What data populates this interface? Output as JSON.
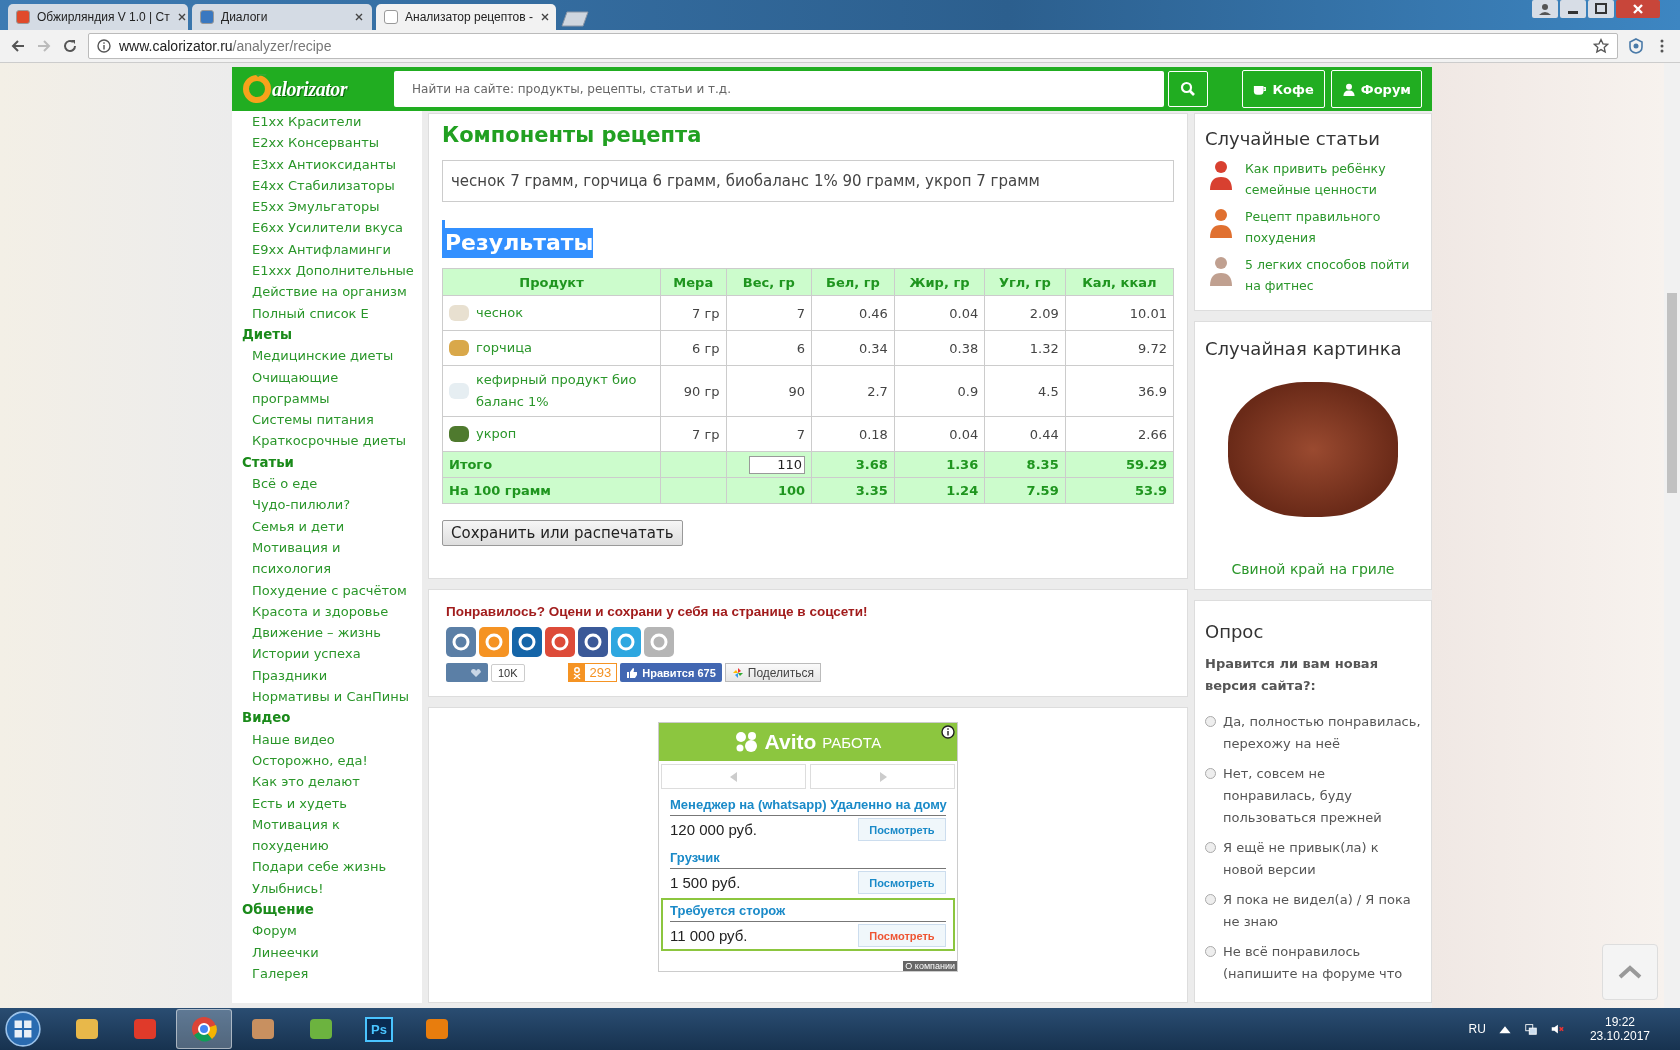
{
  "browser": {
    "tabs": [
      {
        "title": "Обжирляндия V 1.0 | Ст",
        "selected": false
      },
      {
        "title": "Диалоги",
        "selected": false
      },
      {
        "title": "Анализатор рецептов -",
        "selected": true
      }
    ],
    "url_host": "www.calorizator.ru",
    "url_path": "/analyzer/recipe"
  },
  "header": {
    "logo": "alorizator",
    "search_placeholder": "Найти на сайте: продукты, рецепты, статьи и т.д.",
    "buttons": [
      "Кофе",
      "Форум"
    ]
  },
  "sidebar": {
    "sections": [
      {
        "items": [
          "E1xx Красители",
          "E2xx Консерванты",
          "E3xx Антиоксиданты",
          "E4xx Стабилизаторы",
          "E5xx Эмульгаторы",
          "E6xx Усилители вкуса",
          "E9xx Антифламинги",
          "E1xxx Дополнительные",
          "Действие на организм",
          "Полный список Е"
        ]
      },
      {
        "heading": "Диеты",
        "items": [
          "Медицинские диеты",
          "Очищающие программы",
          "Системы питания",
          "Краткосрочные диеты"
        ]
      },
      {
        "heading": "Статьи",
        "items": [
          "Всё о еде",
          "Чудо-пилюли?",
          "Семья и дети",
          "Мотивация и психология",
          "Похудение с расчётом",
          "Красота и здоровье",
          "Движение – жизнь",
          "Истории успеха",
          "Праздники",
          "Нормативы и СанПины"
        ]
      },
      {
        "heading": "Видео",
        "items": [
          "Наше видео",
          "Осторожно, еда!",
          "Как это делают",
          "Есть и худеть",
          "Мотивация к похудению",
          "Подари себе жизнь",
          "Улыбнись!"
        ]
      },
      {
        "heading": "Общение",
        "items": [
          "Форум",
          "Линеечки",
          "Галерея"
        ]
      }
    ]
  },
  "recipe": {
    "title": "Компоненты рецепта",
    "ingredients": "чеснок 7 грамм, горчица 6 грамм, биобаланс 1% 90 грамм, укроп 7 грамм",
    "results_title": "Результаты",
    "results_highlighted": true,
    "table": {
      "columns": [
        "Продукт",
        "Мера",
        "Вес, гр",
        "Бел, гр",
        "Жир, гр",
        "Угл, гр",
        "Кал, ккал"
      ],
      "rows": [
        {
          "kind": "product",
          "name": "чеснок",
          "measure": "7 гр",
          "weight": "7",
          "protein": "0.46",
          "fat": "0.04",
          "carbs": "2.09",
          "kcal": "10.01"
        },
        {
          "kind": "product",
          "name": "горчица",
          "measure": "6 гр",
          "weight": "6",
          "protein": "0.34",
          "fat": "0.38",
          "carbs": "1.32",
          "kcal": "9.72"
        },
        {
          "kind": "product",
          "name": "кефирный продукт био баланс 1%",
          "measure": "90 гр",
          "weight": "90",
          "protein": "2.7",
          "fat": "0.9",
          "carbs": "4.5",
          "kcal": "36.9"
        },
        {
          "kind": "product",
          "name": "укроп",
          "measure": "7 гр",
          "weight": "7",
          "protein": "0.18",
          "fat": "0.04",
          "carbs": "0.44",
          "kcal": "2.66"
        },
        {
          "kind": "total",
          "name": "Итого",
          "weight_editable": true,
          "weight": "110",
          "protein": "3.68",
          "fat": "1.36",
          "carbs": "8.35",
          "kcal": "59.29"
        },
        {
          "kind": "total",
          "name": "На 100 грамм",
          "weight_editable": false,
          "weight": "100",
          "protein": "3.35",
          "fat": "1.24",
          "carbs": "7.59",
          "kcal": "53.9"
        }
      ]
    },
    "save_button": "Сохранить или распечатать"
  },
  "social": {
    "heading": "Понравилось? Оцени и сохрани у себя на странице в соцсети!",
    "vk_count": "10K",
    "ok_count": "293",
    "fb_like": "Нравится 675",
    "share": "Поделиться"
  },
  "ad": {
    "brand": "Avito",
    "brand_sub": "РАБОТА",
    "jobs": [
      {
        "title": "Менеджер на (whatsapp) Удаленно на дому",
        "salary": "120 000 руб.",
        "button": "Посмотреть",
        "selected": false
      },
      {
        "title": "Грузчик",
        "salary": "1 500 руб.",
        "button": "Посмотреть",
        "selected": false
      },
      {
        "title": "Требуется сторож",
        "salary": "11 000 руб.",
        "button": "Посмотреть",
        "selected": true
      }
    ],
    "about": "О компании"
  },
  "articles": {
    "title": "Случайные статьи",
    "items": [
      "Как привить ребёнку семейные ценности",
      "Рецепт правильного похудения",
      "5 легких способов пойти на фитнес"
    ]
  },
  "picture": {
    "title": "Случайная картинка",
    "caption": "Свиной край на гриле"
  },
  "poll": {
    "title": "Опрос",
    "question": "Нравится ли вам новая версия сайта?:",
    "options": [
      {
        "label": "Да, полностью понравилась, перехожу на неё",
        "selected": false
      },
      {
        "label": "Нет, совсем не понравилась, буду пользоваться прежней",
        "selected": false
      },
      {
        "label": "Я ещё не привык(ла) к новой версии",
        "selected": false
      },
      {
        "label": "Я пока не видел(а) / Я пока не знаю",
        "selected": false
      },
      {
        "label": "Не всё понравилось (напишите на форуме что",
        "selected": false
      }
    ]
  },
  "taskbar": {
    "ps_label": "Ps",
    "language": "RU",
    "time": "19:22",
    "date": "23.10.2017"
  }
}
